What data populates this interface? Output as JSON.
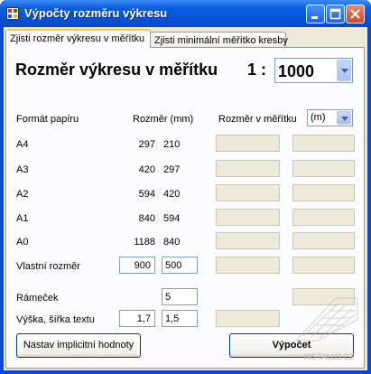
{
  "window": {
    "title": "Výpočty rozměru výkresu"
  },
  "tabs": [
    {
      "label": "Zjisti rozměr výkresu v měřítku",
      "active": true
    },
    {
      "label": "Zjisti minimální měřítko kresby",
      "active": false
    }
  ],
  "main": {
    "heading": "Rozměr výkresu v měřítku",
    "ratio_prefix": "1 :",
    "scale_value": "1000",
    "headers": {
      "format": "Formát papíru",
      "size": "Rozměr (mm)",
      "scaled": "Rozměr v měřítku",
      "unit": "(m)"
    },
    "rows": [
      {
        "label": "A4",
        "w": "297",
        "h": "210"
      },
      {
        "label": "A3",
        "w": "420",
        "h": "297"
      },
      {
        "label": "A2",
        "w": "594",
        "h": "420"
      },
      {
        "label": "A1",
        "w": "840",
        "h": "594"
      },
      {
        "label": "A0",
        "w": "1188",
        "h": "840"
      }
    ],
    "custom": {
      "label": "Vlastní rozměr",
      "w": "900",
      "h": "500"
    },
    "frame": {
      "label": "Rámeček",
      "value": "5"
    },
    "text_size": {
      "label": "Výška, šířka textu",
      "h": "1,7",
      "w": "1,5"
    },
    "buttons": {
      "defaults": "Nastav implicitní hodnoty",
      "calculate": "Výpočet"
    }
  },
  "watermark": "INSTALUJ.CZ",
  "colors": {
    "titlebar": "#0553d6",
    "client": "#ece9d8",
    "tab_highlight": "#ffc83c"
  }
}
